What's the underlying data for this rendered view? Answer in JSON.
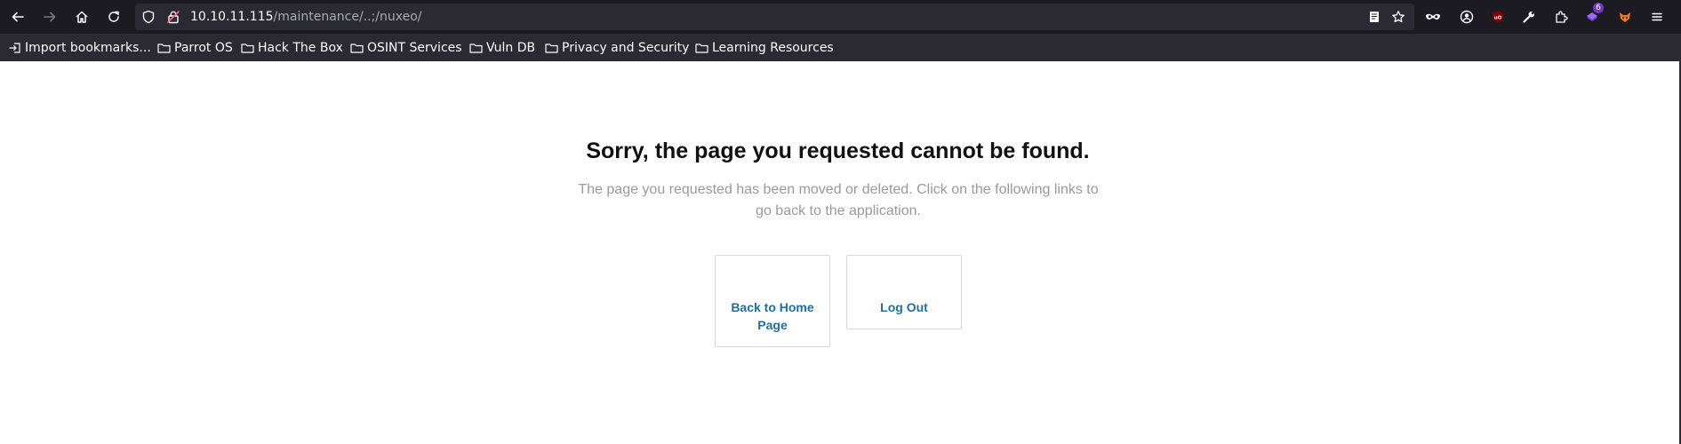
{
  "browser": {
    "url_host": "10.10.11.115",
    "url_path": "/maintenance/..;/nuxeo/",
    "extension_badge": "6",
    "nav_icons": [
      "back-arrow-icon",
      "forward-arrow-icon",
      "home-icon",
      "reload-icon"
    ],
    "toolbar_icons": [
      "reader-view-icon",
      "bookmark-star-icon",
      "private-mask-icon",
      "account-icon",
      "ublock-icon",
      "wrench-icon",
      "extensions-icon",
      "purple-extension-icon",
      "foxyproxy-icon",
      "menu-hamburger-icon"
    ]
  },
  "bookmarks": [
    {
      "label": "Import bookmarks...",
      "icon": "import-icon"
    },
    {
      "label": "Parrot OS",
      "icon": "folder-icon"
    },
    {
      "label": "Hack The Box",
      "icon": "folder-icon"
    },
    {
      "label": "OSINT Services",
      "icon": "folder-icon"
    },
    {
      "label": "Vuln DB",
      "icon": "folder-icon"
    },
    {
      "label": "Privacy and Security",
      "icon": "folder-icon"
    },
    {
      "label": "Learning Resources",
      "icon": "folder-icon"
    }
  ],
  "page": {
    "title": "Sorry, the page you requested cannot be found.",
    "description": "The page you requested has been moved or deleted. Click on the following links to go back to the application.",
    "links": [
      {
        "label": "Back to Home Page"
      },
      {
        "label": "Log Out"
      }
    ]
  },
  "colors": {
    "chrome_dark": "#1c1b22",
    "chrome": "#2b2a33",
    "link": "#1f6f9e",
    "muted_text": "#9a9a9a"
  }
}
